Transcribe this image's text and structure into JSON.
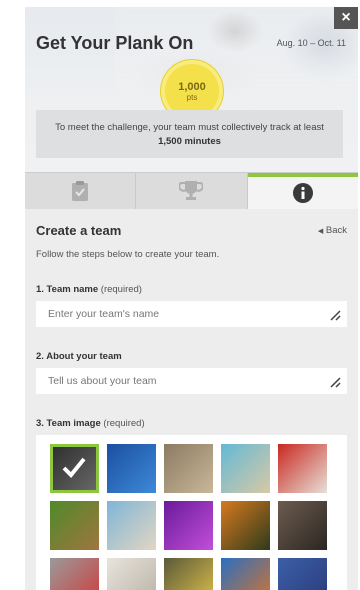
{
  "header": {
    "title": "Get Your Plank On",
    "dates": "Aug. 10 – Oct. 11",
    "close_label": "×",
    "points_value": "1,000",
    "points_unit": "pts",
    "goal_text": "To meet the challenge, your team must collectively track at least",
    "goal_amount": "1,500 minutes"
  },
  "tabs": [
    {
      "icon": "clipboard-check-icon",
      "active": false
    },
    {
      "icon": "trophy-icon",
      "active": false
    },
    {
      "icon": "info-icon",
      "active": true
    }
  ],
  "create_team": {
    "title": "Create a team",
    "back_label": "Back",
    "description": "Follow the steps below to create your team.",
    "team_name_label": "1. Team name",
    "team_name_required": "(required)",
    "team_name_placeholder": "Enter your team's name",
    "about_label": "2. About your team",
    "about_placeholder": "Tell us about your team",
    "image_label": "3. Team image",
    "image_required": "(required)"
  },
  "team_images": [
    {
      "name": "eagle",
      "selected": true,
      "colors": [
        "#2b2b2b",
        "#6b6b6b"
      ]
    },
    {
      "name": "dolphins",
      "selected": false,
      "colors": [
        "#1b4fa0",
        "#3d8ad8"
      ]
    },
    {
      "name": "hikers",
      "selected": false,
      "colors": [
        "#8c7a62",
        "#c9b79a"
      ]
    },
    {
      "name": "beach",
      "selected": false,
      "colors": [
        "#63b9d6",
        "#d8c9a5"
      ]
    },
    {
      "name": "red-car",
      "selected": false,
      "colors": [
        "#c8281f",
        "#e8e0d8"
      ]
    },
    {
      "name": "squirrel",
      "selected": false,
      "colors": [
        "#4f8a2a",
        "#a0753f"
      ]
    },
    {
      "name": "surfers",
      "selected": false,
      "colors": [
        "#7fb5d8",
        "#e2d6c2"
      ]
    },
    {
      "name": "purple-flower",
      "selected": false,
      "colors": [
        "#6a1a9a",
        "#c24fd8"
      ]
    },
    {
      "name": "tiger",
      "selected": false,
      "colors": [
        "#d77a1e",
        "#2e3a1c"
      ]
    },
    {
      "name": "stones",
      "selected": false,
      "colors": [
        "#6d5c4f",
        "#2c2622"
      ]
    },
    {
      "name": "running-shoes",
      "selected": false,
      "colors": [
        "#9a9a9a",
        "#d03a3a"
      ]
    },
    {
      "name": "bicycle",
      "selected": false,
      "colors": [
        "#e8e4dc",
        "#b8b0a4"
      ]
    },
    {
      "name": "owl",
      "selected": false,
      "colors": [
        "#5b5a3a",
        "#e0c24a"
      ]
    },
    {
      "name": "basketball",
      "selected": false,
      "colors": [
        "#2a6fc0",
        "#d9752a"
      ]
    },
    {
      "name": "runners",
      "selected": false,
      "colors": [
        "#3c5fa8",
        "#2a3a78"
      ]
    }
  ]
}
